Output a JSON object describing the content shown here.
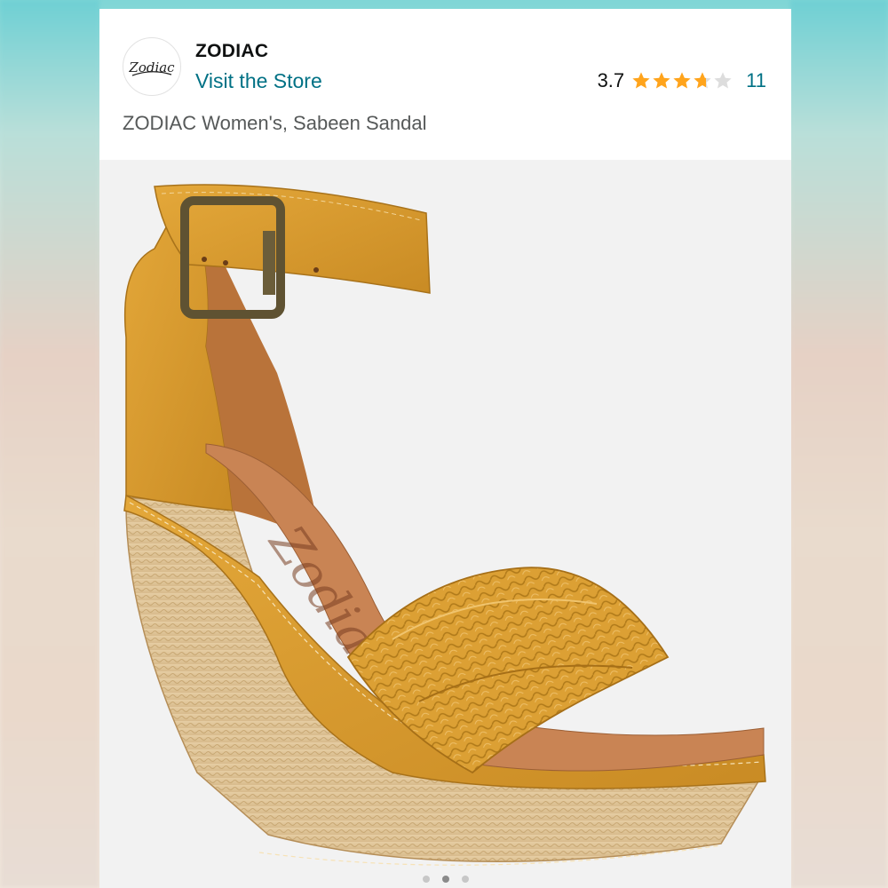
{
  "store": {
    "brand": "ZODIAC",
    "logo_text": "Zodiac",
    "visit_label": "Visit the Store"
  },
  "rating": {
    "value": "3.7",
    "stars": 3.7,
    "max_stars": 5,
    "count": "11"
  },
  "product": {
    "title": "ZODIAC Women's, Sabeen Sandal",
    "insole_logo": "Zodiac"
  },
  "carousel": {
    "pages": 3,
    "active_index": 1
  },
  "colors": {
    "link": "#007185",
    "star": "#FFA41C",
    "star_empty": "#DDDDDD"
  }
}
